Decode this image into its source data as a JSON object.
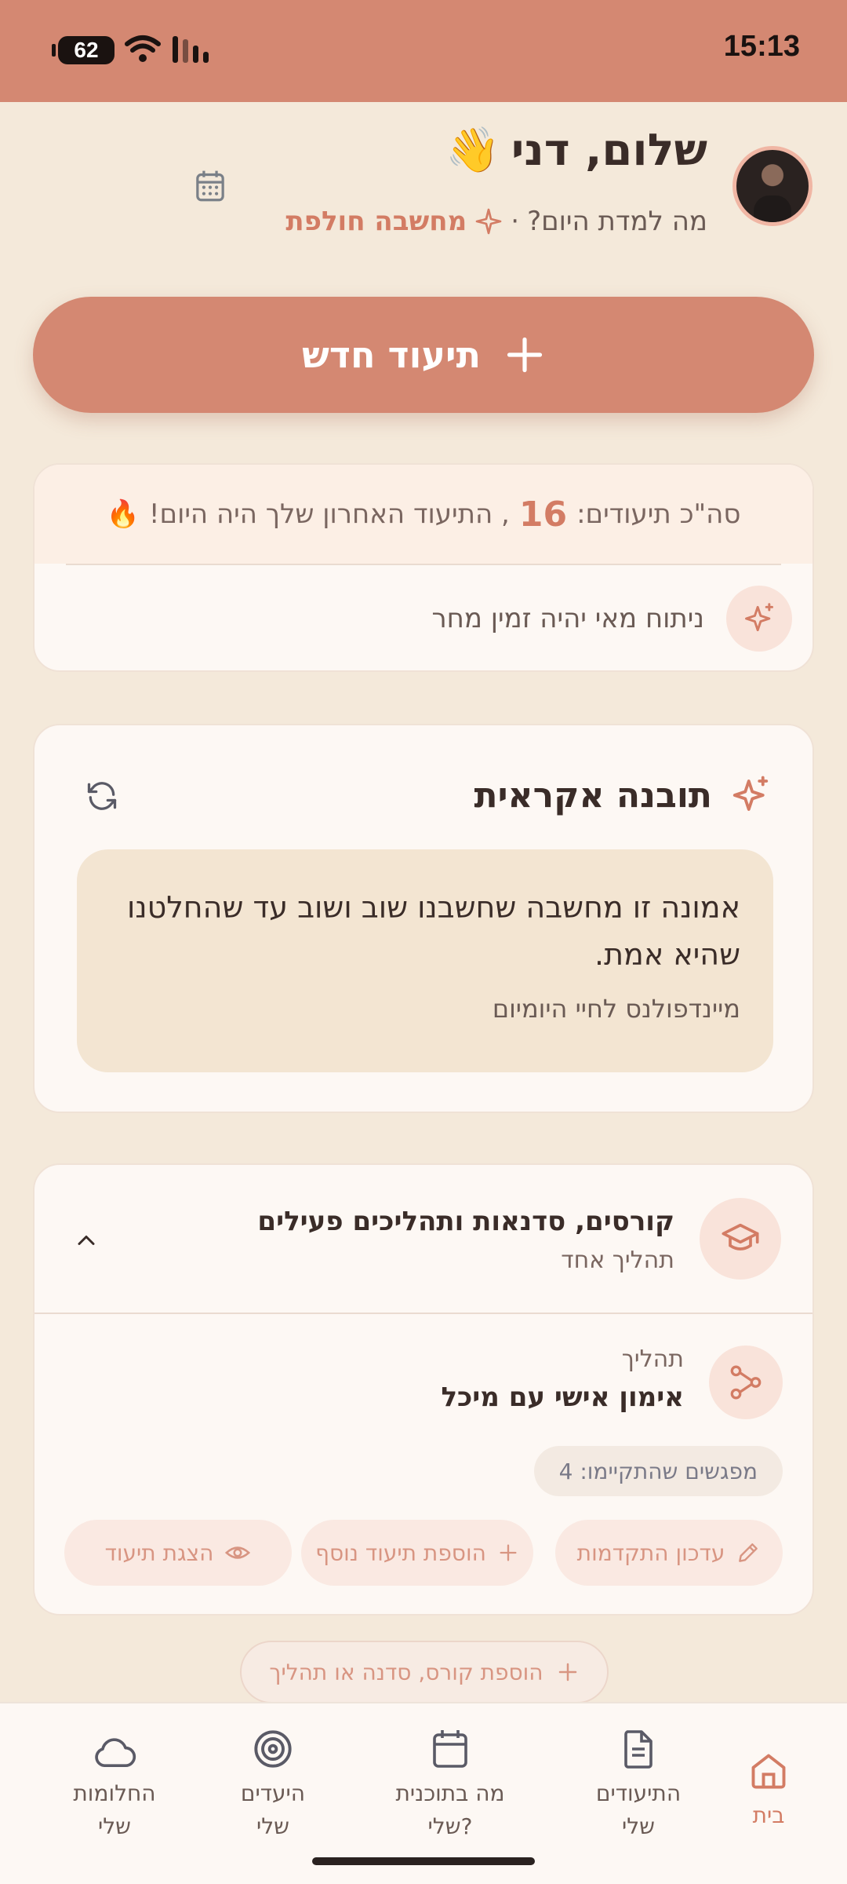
{
  "status_bar": {
    "time": "15:13",
    "battery": "62"
  },
  "header": {
    "greeting": "שלום, דני",
    "wave_emoji": "👋",
    "question": "מה למדת היום?",
    "dot": "·",
    "highlight": "מחשבה חולפת"
  },
  "new_entry_button": {
    "label": "תיעוד חדש"
  },
  "stats": {
    "total_prefix": "סה\"כ תיעודים:",
    "total_count": "16",
    "suffix": ", התיעוד האחרון שלך היה היום!",
    "fire_emoji": "🔥",
    "analysis_text": "ניתוח מאי יהיה זמין מחר"
  },
  "insight": {
    "title": "תובנה אקראית",
    "quote": "אמונה זו מחשבה שחשבנו שוב ושוב עד שהחלטנו שהיא אמת.",
    "source": "מיינדפולנס לחיי היומיום"
  },
  "courses": {
    "title": "קורסים, סדנאות ותהליכים פעילים",
    "subtitle": "תהליך אחד",
    "process_label": "תהליך",
    "process_name": "אימון אישי עם מיכל",
    "meetings": "מפגשים שהתקיימו: 4",
    "actions": {
      "update": "עדכון התקדמות",
      "add_entry": "הוספת תיעוד נוסף",
      "view": "הצגת תיעוד"
    },
    "add_course": "הוספת קורס, סדנה או תהליך"
  },
  "bottom_nav": [
    {
      "label_1": "בית",
      "label_2": "",
      "icon": "home-icon",
      "active": true
    },
    {
      "label_1": "התיעודים",
      "label_2": "שלי",
      "icon": "document-icon"
    },
    {
      "label_1": "מה בתוכנית",
      "label_2": "שלי?",
      "icon": "calendar-icon"
    },
    {
      "label_1": "היעדים",
      "label_2": "שלי",
      "icon": "target-icon"
    },
    {
      "label_1": "החלומות",
      "label_2": "שלי",
      "icon": "cloud-icon"
    }
  ],
  "colors": {
    "accent": "#d48872",
    "background": "#f4e9da",
    "card": "#fdf8f4"
  }
}
